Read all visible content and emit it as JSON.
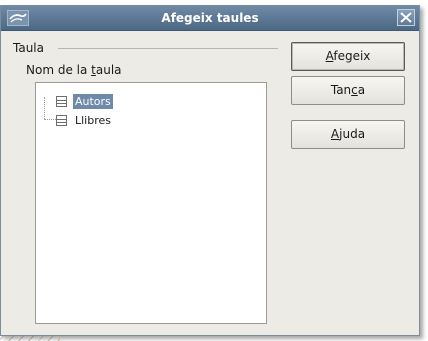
{
  "window": {
    "title": "Afegeix taules"
  },
  "group": {
    "label": "Taula"
  },
  "field": {
    "label_prefix": "Nom de la ",
    "label_mnemonic": "t",
    "label_suffix": "aula"
  },
  "tree": {
    "items": [
      {
        "label": "Autors",
        "selected": true
      },
      {
        "label": "Llibres",
        "selected": false
      }
    ]
  },
  "buttons": {
    "add": {
      "mnemonic": "A",
      "rest": "fegeix"
    },
    "close": {
      "prefix": "Tan",
      "mnemonic": "c",
      "rest": "a"
    },
    "help": {
      "mnemonic": "A",
      "rest": "juda"
    }
  },
  "colors": {
    "titlebar": "#5b7794",
    "selection": "#6e8aa8",
    "dialog_bg": "#ecebe6"
  },
  "icons": {
    "app": "openoffice-gull-icon",
    "close": "close-icon",
    "table": "table-icon"
  }
}
